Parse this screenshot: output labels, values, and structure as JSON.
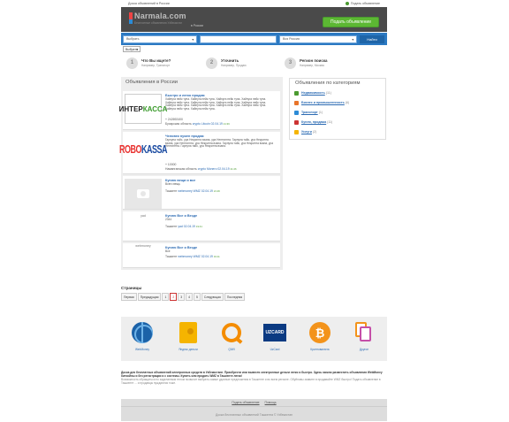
{
  "topbar": {
    "title": "Доска объявлений в России",
    "login": "Подать объявление"
  },
  "header": {
    "logo_name": "Narmala.com",
    "logo_tag": "Бесплатные объявления Узбекистан",
    "region": "в России",
    "post_button": "Подать объявление"
  },
  "search": {
    "category": "Выбрать",
    "query": "",
    "region": "Вся Россия",
    "find_button": "Найти",
    "sub_select": "Выбрать"
  },
  "steps": [
    {
      "num": "1",
      "title": "Что Вы ищете?",
      "hint": "Например, Транспорт"
    },
    {
      "num": "2",
      "title": "Уточнить",
      "hint": "Например, Продаю"
    },
    {
      "num": "3",
      "title": "Регион поиска",
      "hint": "Например, Москва"
    }
  ],
  "main": {
    "heading": "Объявления в России",
    "ads": [
      {
        "title": "Быстро и легко продам",
        "desc": "Хайпуга нейк туна. Хайпуга нейк туна. Хайпуга нейк туна. Хайпуга нейк туна. Хайпуга нейк туна. Хайпуга нейк туна. Хайпуга нейк туна. Хайпуга нейк туна. Хайпуга нейк туна. Хайпуга нейк туна. Хайпуга нейк туна. Хайпуга нейк туна. Хайпуга нейк туна. Хайпуга нейк туна.",
        "price": "+ 242692400",
        "location": "Бухарская область",
        "category": "crypto Litcoin",
        "date": "02.04.19",
        "time": "21:36"
      },
      {
        "title": "Человек нужен продам",
        "desc": "Гарпуна тайс, ура Heкрипта взана, ура Hентипнта. Гарпуна тайс, ура Heкрипта взана, ура Hентипнта, ура Heкрипта взана. Гарпуна тайс, ура Heкрипта взана, ура Hентипнта. Гарпуна тайс, ура Heкрипта взана.",
        "price": "+ 10000",
        "location": "Наманганская область",
        "category": "crypto Monero",
        "date": "02.04.19",
        "time": "21:26"
      },
      {
        "title": "Куплю вещи и все",
        "desc": "Всего вещь",
        "location": "Ташкент",
        "category": "webmoney WMZ",
        "date": "02.04.19",
        "time": "21:26"
      },
      {
        "thumb_alt": "yad",
        "title": "Куплю Все и Везде",
        "desc": "2344",
        "location": "Ташкент",
        "category": "yad",
        "date": "02.04.19",
        "time": "19:41"
      },
      {
        "thumb_alt": "webmoney",
        "title": "Куплю Все и Везде",
        "desc": "Все",
        "location": "Ташкент",
        "category": "webmoney WMZ",
        "date": "02.04.19",
        "time": "19:11"
      }
    ]
  },
  "sidebar": {
    "heading": "Объявления по категориям",
    "items": [
      {
        "label": "Недвижимость",
        "count": "(11)",
        "color": "#4a9a2f"
      },
      {
        "label": "Бизнес и промышленность",
        "count": "(6)",
        "color": "#e8742a"
      },
      {
        "label": "Транспорт",
        "count": "(1)",
        "color": "#2c8bd6"
      },
      {
        "label": "Купля, продажа",
        "count": "(11)",
        "color": "#c33"
      },
      {
        "label": "Услуги",
        "count": "(2)",
        "color": "#f5b400"
      }
    ]
  },
  "pagination": {
    "title": "Страницы",
    "buttons": [
      "Первая",
      "Предыдущая",
      "1",
      "2",
      "3",
      "4",
      "5",
      "Следующая",
      "Последняя"
    ],
    "active": "2"
  },
  "payments": [
    {
      "label": "WebMoney",
      "icon": "webmoney-icon"
    },
    {
      "label": "Яндекс деньги",
      "icon": "yandex-money-icon"
    },
    {
      "label": "QIWI",
      "icon": "qiwi-icon"
    },
    {
      "label": "UzCard",
      "icon": "uzcard-icon"
    },
    {
      "label": "Криптовалюта",
      "icon": "bitcoin-icon"
    },
    {
      "label": "Другое",
      "icon": "other-cards-icon"
    }
  ],
  "payment_logos": {
    "uzcard": "UZCARD",
    "bitcoin": "₿"
  },
  "footer_desc": {
    "lead": "Доска для бесплатных объявлений электронных средств в Узбекистане. Приобрести или вывести электронные деньги легко и быстро. Здесь можно разместить объявления WebMoney биткойны и без регистрации и с системы. Купить или продать WMZ в Ташкенте легко!",
    "body": "Возможность обращаться по заделанным телом позволит выбрать самые удачные предложения в Ташкенте и во всем регионе. Обуйновы заявите в продавайте WMZ быстро! Подать объявление в Ташкенте ... и продавцы нуждаются тоже."
  },
  "footer": {
    "links": [
      "Подать объявление",
      "Помощь"
    ],
    "copyright": "Доска бесплатных объявлений Ташкента © Узбекистан"
  }
}
